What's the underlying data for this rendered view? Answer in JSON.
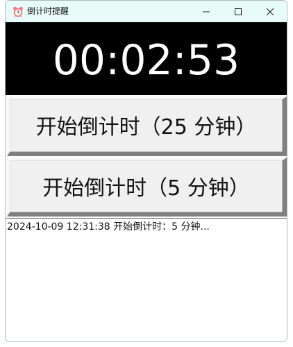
{
  "window": {
    "title": "倒计时提醒"
  },
  "titlebar": {
    "app_icon": "alarm-clock-icon",
    "minimize_icon": "minimize-icon",
    "maximize_icon": "maximize-icon",
    "close_icon": "close-icon",
    "background": "#e9fbf8"
  },
  "timer": {
    "display": "00:02:53",
    "background": "#000000",
    "color": "#ffffff"
  },
  "buttons": {
    "start_25": "开始倒计时（25 分钟）",
    "start_5": "开始倒计时（5 分钟）"
  },
  "log": {
    "entries": [
      "2024-10-09 12:31:38 开始倒计时：5 分钟..."
    ]
  }
}
